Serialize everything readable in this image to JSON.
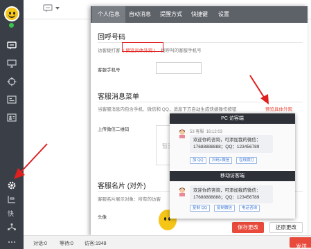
{
  "tabs": [
    "个人信息",
    "自动消息",
    "提醒方式",
    "快捷键",
    "设置"
  ],
  "callback": {
    "title": "回呼号码",
    "desc_prefix": "访客拨打客",
    "preview_link": "( 预览具体外观 )",
    "desc_suffix": "拨呼叫的客服手机号",
    "phone_label": "客服手机号",
    "phone_value": ""
  },
  "menu": {
    "title": "客服消息菜单",
    "desc": "当客服消息内包含手机、微信和 QQ，消息下方自动生成快捷操作按钮",
    "preview_link": "预览具体外观",
    "qr_label": "上传微信二维码",
    "qr_placeholder": "暂无"
  },
  "card": {
    "title": "客服名片 (对外)",
    "desc": "客服名片展示对象：所有的访客",
    "avatar_label": "头像"
  },
  "buttons": {
    "save": "保存更改",
    "restore": "还原更改"
  },
  "preview": {
    "pc_title": "PC 访客端",
    "mobile_title": "移动访客端",
    "sender": "53 客服",
    "time": "16:12:03",
    "message_line1": "欢迎你的咨询，可添加我的微信：",
    "message_line2": "17688888888；QQ：123456789",
    "pc_buttons": [
      "加 QQ",
      "扫码+微信",
      "在线拨打"
    ],
    "mobile_buttons": [
      "复制 QQ",
      "复制微信",
      "电话咨询"
    ]
  },
  "status": {
    "dialog": "对话:0",
    "waiting": "等待:0",
    "visitors": "访客:1948",
    "send": "发送"
  }
}
